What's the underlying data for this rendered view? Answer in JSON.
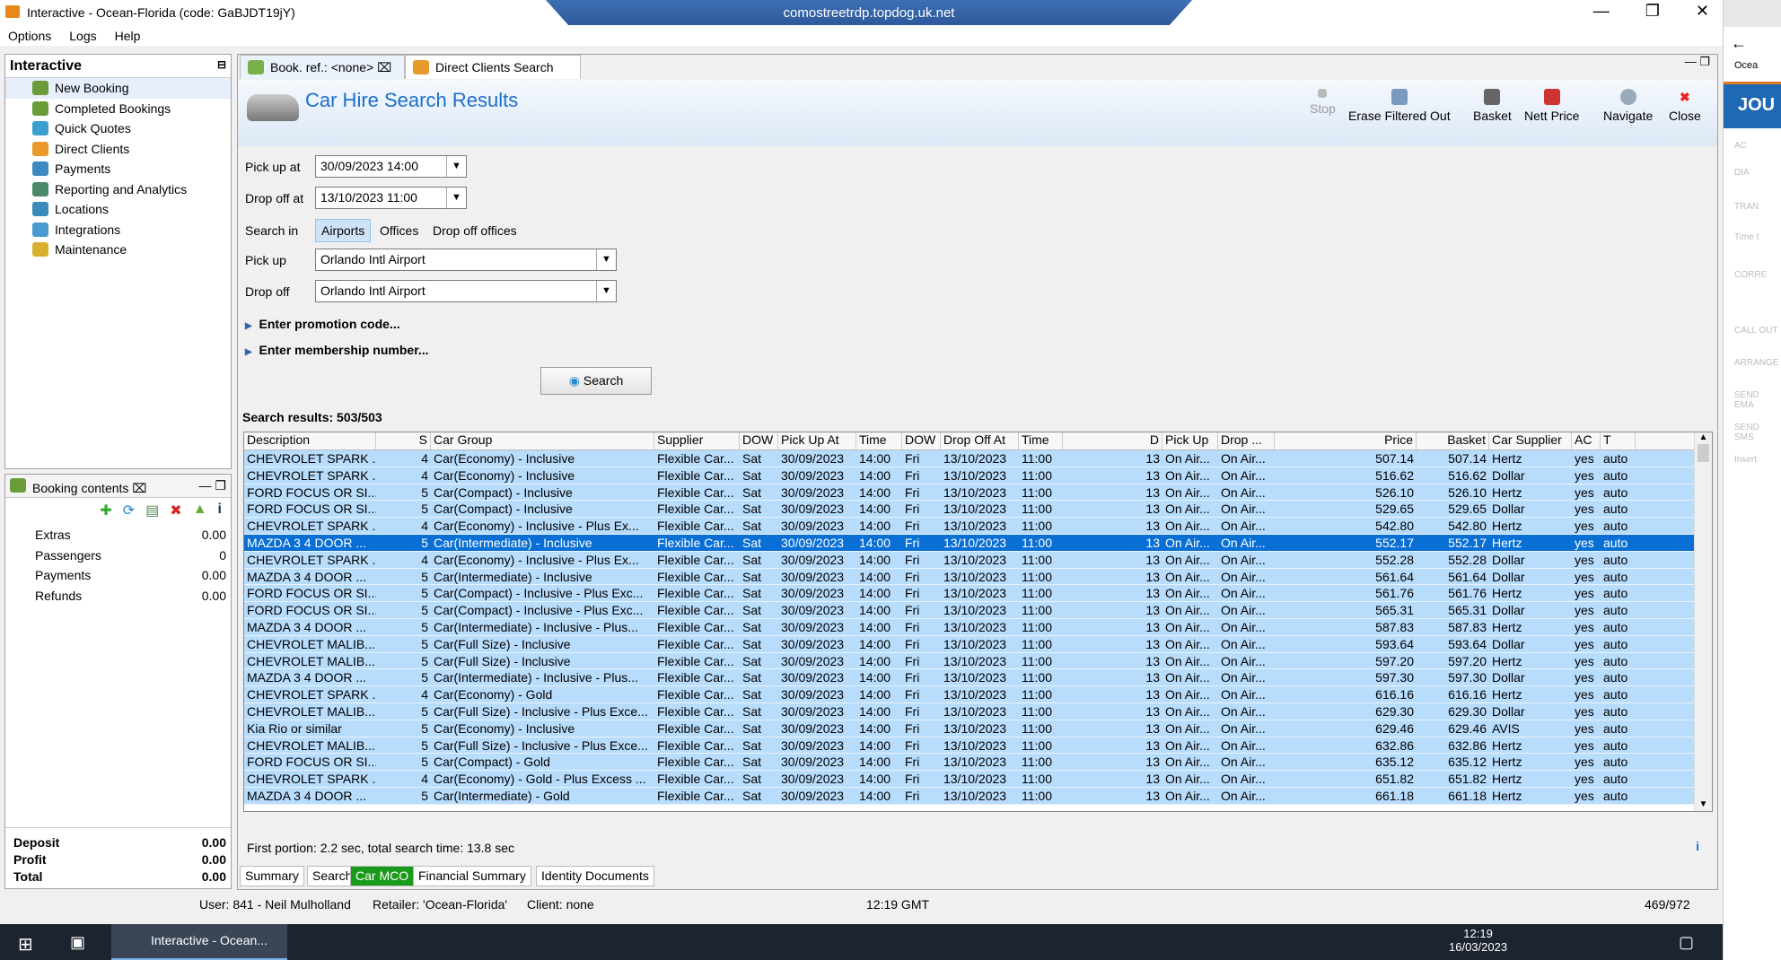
{
  "window": {
    "title": "Interactive - Ocean-Florida (code: GaBJDT19jY)",
    "rdp_host": "comostreetrdp.topdog.uk.net"
  },
  "menu": [
    "Options",
    "Logs",
    "Help"
  ],
  "nav": {
    "title": "Interactive",
    "items": [
      "New Booking",
      "Completed Bookings",
      "Quick Quotes",
      "Direct Clients",
      "Payments",
      "Reporting and Analytics",
      "Locations",
      "Integrations",
      "Maintenance"
    ]
  },
  "booking": {
    "title": "Booking contents",
    "rows": [
      {
        "label": "Extras",
        "value": "0.00"
      },
      {
        "label": "Passengers",
        "value": "0"
      },
      {
        "label": "Payments",
        "value": "0.00"
      },
      {
        "label": "Refunds",
        "value": "0.00"
      }
    ],
    "totals": [
      {
        "label": "Deposit",
        "value": "0.00"
      },
      {
        "label": "Profit",
        "value": "0.00"
      },
      {
        "label": "Total",
        "value": "0.00"
      }
    ]
  },
  "tabs": [
    "Book. ref.: <none>",
    "Direct Clients Search"
  ],
  "header": {
    "title": "Car Hire Search Results",
    "toolbar": [
      "Stop",
      "Erase Filtered Out",
      "Basket",
      "Nett Price",
      "Navigate",
      "Close"
    ]
  },
  "form": {
    "pickup_at_label": "Pick up at",
    "pickup_at": "30/09/2023 14:00",
    "dropoff_at_label": "Drop off at",
    "dropoff_at": "13/10/2023 11:00",
    "search_in_label": "Search in",
    "search_in_options": [
      "Airports",
      "Offices",
      "Drop off offices"
    ],
    "pickup_label": "Pick up",
    "pickup": "Orlando Intl Airport",
    "dropoff_label": "Drop off",
    "dropoff": "Orlando Intl Airport",
    "promo": "Enter promotion code...",
    "membership": "Enter membership number...",
    "search_button": "Search"
  },
  "results_label": "Search results: 503/503",
  "columns": [
    "Description",
    "S",
    "Car Group",
    "Supplier",
    "DOW",
    "Pick Up At",
    "Time",
    "DOW",
    "Drop Off At",
    "Time",
    "D",
    "Pick Up",
    "Drop ...",
    "Price",
    "Basket",
    "Car Supplier",
    "AC",
    "T"
  ],
  "rows": [
    [
      "CHEVROLET SPARK ...",
      "4",
      "Car(Economy) - Inclusive",
      "507.14",
      "Hertz"
    ],
    [
      "CHEVROLET SPARK ...",
      "4",
      "Car(Economy) - Inclusive",
      "516.62",
      "Dollar"
    ],
    [
      "FORD FOCUS OR SI...",
      "5",
      "Car(Compact) - Inclusive",
      "526.10",
      "Hertz"
    ],
    [
      "FORD FOCUS OR SI...",
      "5",
      "Car(Compact) - Inclusive",
      "529.65",
      "Dollar"
    ],
    [
      "CHEVROLET SPARK ...",
      "4",
      "Car(Economy) - Inclusive - Plus Ex...",
      "542.80",
      "Hertz"
    ],
    [
      "MAZDA 3 4 DOOR ...",
      "5",
      "Car(Intermediate) - Inclusive",
      "552.17",
      "Hertz"
    ],
    [
      "CHEVROLET SPARK ...",
      "4",
      "Car(Economy) - Inclusive - Plus Ex...",
      "552.28",
      "Dollar"
    ],
    [
      "MAZDA 3 4 DOOR ...",
      "5",
      "Car(Intermediate) - Inclusive",
      "561.64",
      "Dollar"
    ],
    [
      "FORD FOCUS OR SI...",
      "5",
      "Car(Compact) - Inclusive - Plus Exc...",
      "561.76",
      "Hertz"
    ],
    [
      "FORD FOCUS OR SI...",
      "5",
      "Car(Compact) - Inclusive - Plus Exc...",
      "565.31",
      "Dollar"
    ],
    [
      "MAZDA 3 4 DOOR ...",
      "5",
      "Car(Intermediate) - Inclusive - Plus...",
      "587.83",
      "Hertz"
    ],
    [
      "CHEVROLET MALIB...",
      "5",
      "Car(Full Size) - Inclusive",
      "593.64",
      "Dollar"
    ],
    [
      "CHEVROLET MALIB...",
      "5",
      "Car(Full Size) - Inclusive",
      "597.20",
      "Hertz"
    ],
    [
      "MAZDA 3 4 DOOR ...",
      "5",
      "Car(Intermediate) - Inclusive - Plus...",
      "597.30",
      "Dollar"
    ],
    [
      "CHEVROLET SPARK ...",
      "4",
      "Car(Economy) - Gold",
      "616.16",
      "Hertz"
    ],
    [
      "CHEVROLET MALIB...",
      "5",
      "Car(Full Size) - Inclusive - Plus Exce...",
      "629.30",
      "Dollar"
    ],
    [
      "Kia Rio or similar",
      "5",
      "Car(Economy) - Inclusive",
      "629.46",
      "AVIS"
    ],
    [
      "CHEVROLET MALIB...",
      "5",
      "Car(Full Size) - Inclusive - Plus Exce...",
      "632.86",
      "Hertz"
    ],
    [
      "FORD FOCUS OR SI...",
      "5",
      "Car(Compact) - Gold",
      "635.12",
      "Hertz"
    ],
    [
      "CHEVROLET SPARK ...",
      "4",
      "Car(Economy) - Gold - Plus Excess ...",
      "651.82",
      "Hertz"
    ],
    [
      "MAZDA 3 4 DOOR ...",
      "5",
      "Car(Intermediate) - Gold",
      "661.18",
      "Hertz"
    ]
  ],
  "row_common": {
    "supplier": "Flexible Car...",
    "dow1": "Sat",
    "pickup_at": "30/09/2023",
    "time1": "14:00",
    "dow2": "Fri",
    "dropoff_at": "13/10/2023",
    "time2": "11:00",
    "d": "13",
    "pickup": "On Air...",
    "drop": "On Air...",
    "ac": "yes",
    "t": "auto"
  },
  "selected_row": 5,
  "footer": "First portion: 2.2 sec, total search time: 13.8 sec",
  "bottom_tabs": [
    "Summary",
    "Search",
    "Car MCO",
    "Financial Summary",
    "Identity Documents"
  ],
  "status": {
    "user": "User: 841 - Neil Mulholland",
    "retailer": "Retailer: 'Ocean-Florida'",
    "client": "Client: none",
    "time": "12:19 GMT",
    "count": "469/972"
  },
  "taskbar": {
    "app": "Interactive - Ocean...",
    "clock": "12:19",
    "date": "16/03/2023"
  },
  "side": {
    "tab": "Ocea",
    "banner": "JOU",
    "items": [
      "AC",
      "DIA",
      "TRAN",
      "Time t",
      "CORRE",
      "CALL OUT",
      "ARRANGE",
      "SEND EMA",
      "SEND SMS",
      "Insert"
    ]
  }
}
